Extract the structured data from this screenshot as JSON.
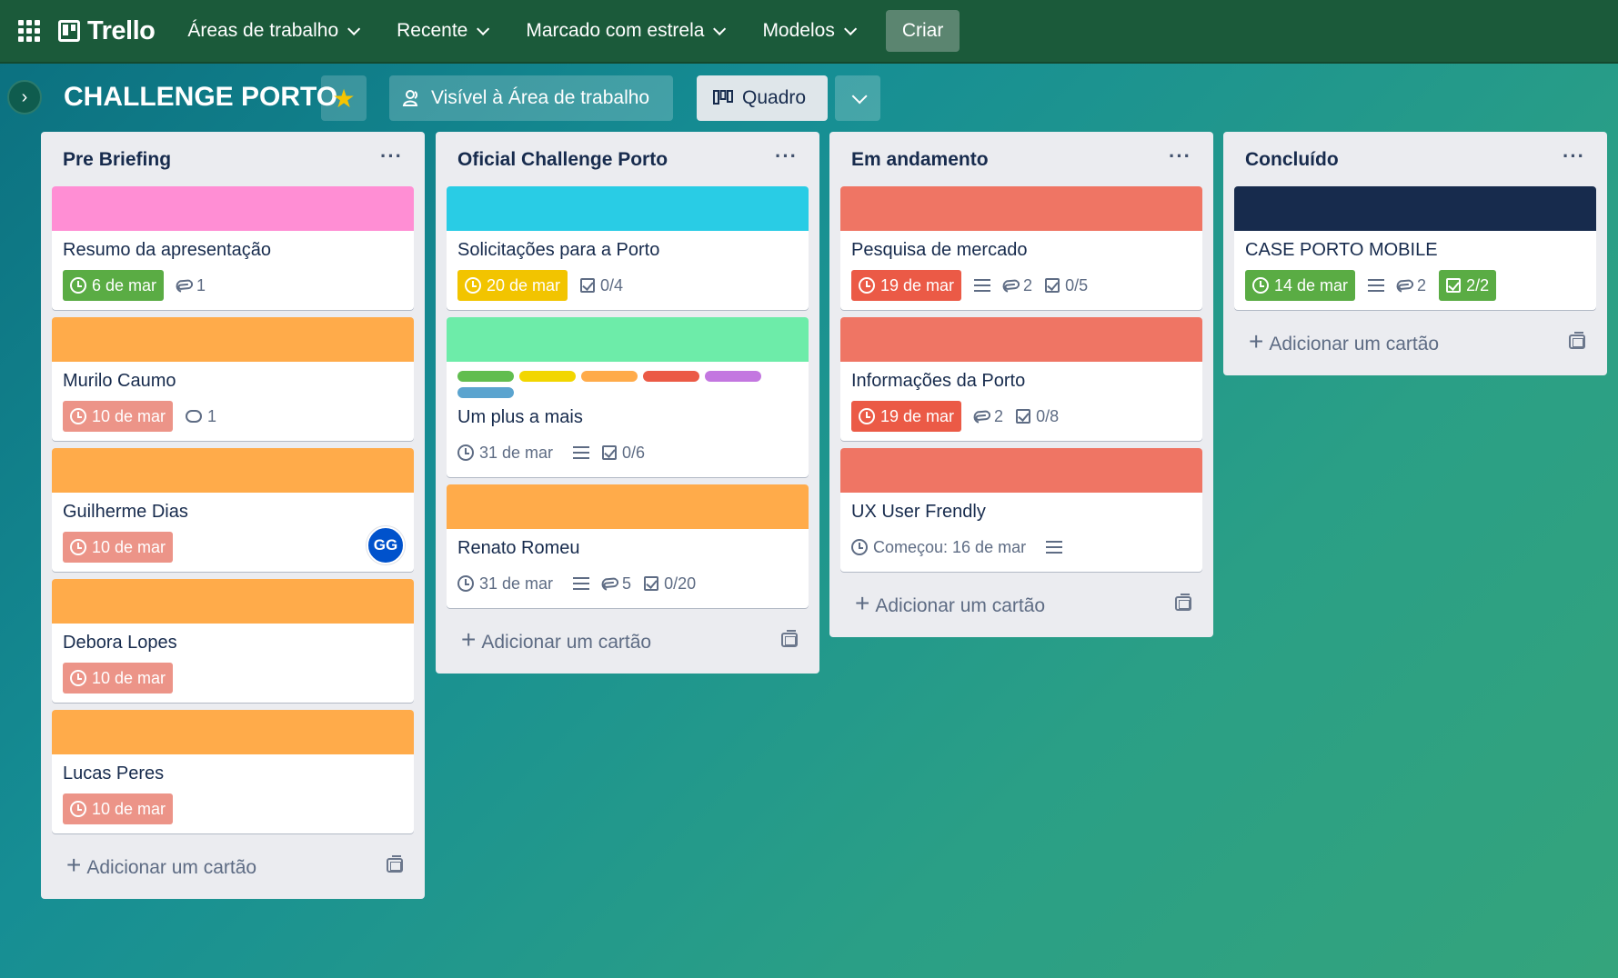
{
  "topnav": {
    "logo": "Trello",
    "menus": [
      {
        "label": "Áreas de trabalho"
      },
      {
        "label": "Recente"
      },
      {
        "label": "Marcado com estrela"
      },
      {
        "label": "Modelos"
      }
    ],
    "create_label": "Criar"
  },
  "board": {
    "title": "CHALLENGE PORTO",
    "visibility_label": "Visível à Área de trabalho",
    "view_label": "Quadro"
  },
  "add_card_label": "Adicionar um cartão",
  "lists": [
    {
      "title": "Pre Briefing",
      "cards": [
        {
          "title": "Resumo da apresentação",
          "cover": "#ff8ed4",
          "due": "6 de mar",
          "due_status": "green",
          "attachments": "1"
        },
        {
          "title": "Murilo Caumo",
          "cover": "#ffab4a",
          "due": "10 de mar",
          "due_status": "redsoft",
          "comments": "1"
        },
        {
          "title": "Guilherme Dias",
          "cover": "#ffab4a",
          "due": "10 de mar",
          "due_status": "redsoft",
          "member": "GG"
        },
        {
          "title": "Debora Lopes",
          "cover": "#ffab4a",
          "due": "10 de mar",
          "due_status": "redsoft"
        },
        {
          "title": "Lucas Peres",
          "cover": "#ffab4a",
          "due": "10 de mar",
          "due_status": "redsoft"
        }
      ]
    },
    {
      "title": "Oficial Challenge Porto",
      "cards": [
        {
          "title": "Solicitações para a Porto",
          "cover": "#29cce5",
          "due": "20 de mar",
          "due_status": "yellow",
          "checklist": "0/4"
        },
        {
          "title": "Um plus a mais",
          "cover": "#6deca9",
          "label_colors": [
            "#61bd4f",
            "#f2d600",
            "#ffab4a",
            "#eb5a46",
            "#c377e0",
            "#5ba4cf"
          ],
          "due": "31 de mar",
          "due_status": "plain",
          "description": true,
          "checklist": "0/6"
        },
        {
          "title": "Renato Romeu",
          "cover": "#ffab4a",
          "due": "31 de mar",
          "due_status": "plain",
          "description": true,
          "attachments": "5",
          "checklist": "0/20"
        }
      ]
    },
    {
      "title": "Em andamento",
      "cards": [
        {
          "title": "Pesquisa de mercado",
          "cover": "#ef7564",
          "due": "19 de mar",
          "due_status": "red",
          "description": true,
          "attachments": "2",
          "checklist": "0/5"
        },
        {
          "title": "Informações da Porto",
          "cover": "#ef7564",
          "due": "19 de mar",
          "due_status": "red",
          "attachments": "2",
          "checklist": "0/8"
        },
        {
          "title": "UX User Frendly",
          "cover": "#ef7564",
          "due": "Começou: 16 de mar",
          "due_status": "plain",
          "description": true
        }
      ]
    },
    {
      "title": "Concluído",
      "cards": [
        {
          "title": "CASE PORTO MOBILE",
          "cover": "#172b4d",
          "due": "14 de mar",
          "due_status": "green",
          "description": true,
          "attachments": "2",
          "checklist": "2/2",
          "checklist_done": true
        }
      ]
    }
  ]
}
